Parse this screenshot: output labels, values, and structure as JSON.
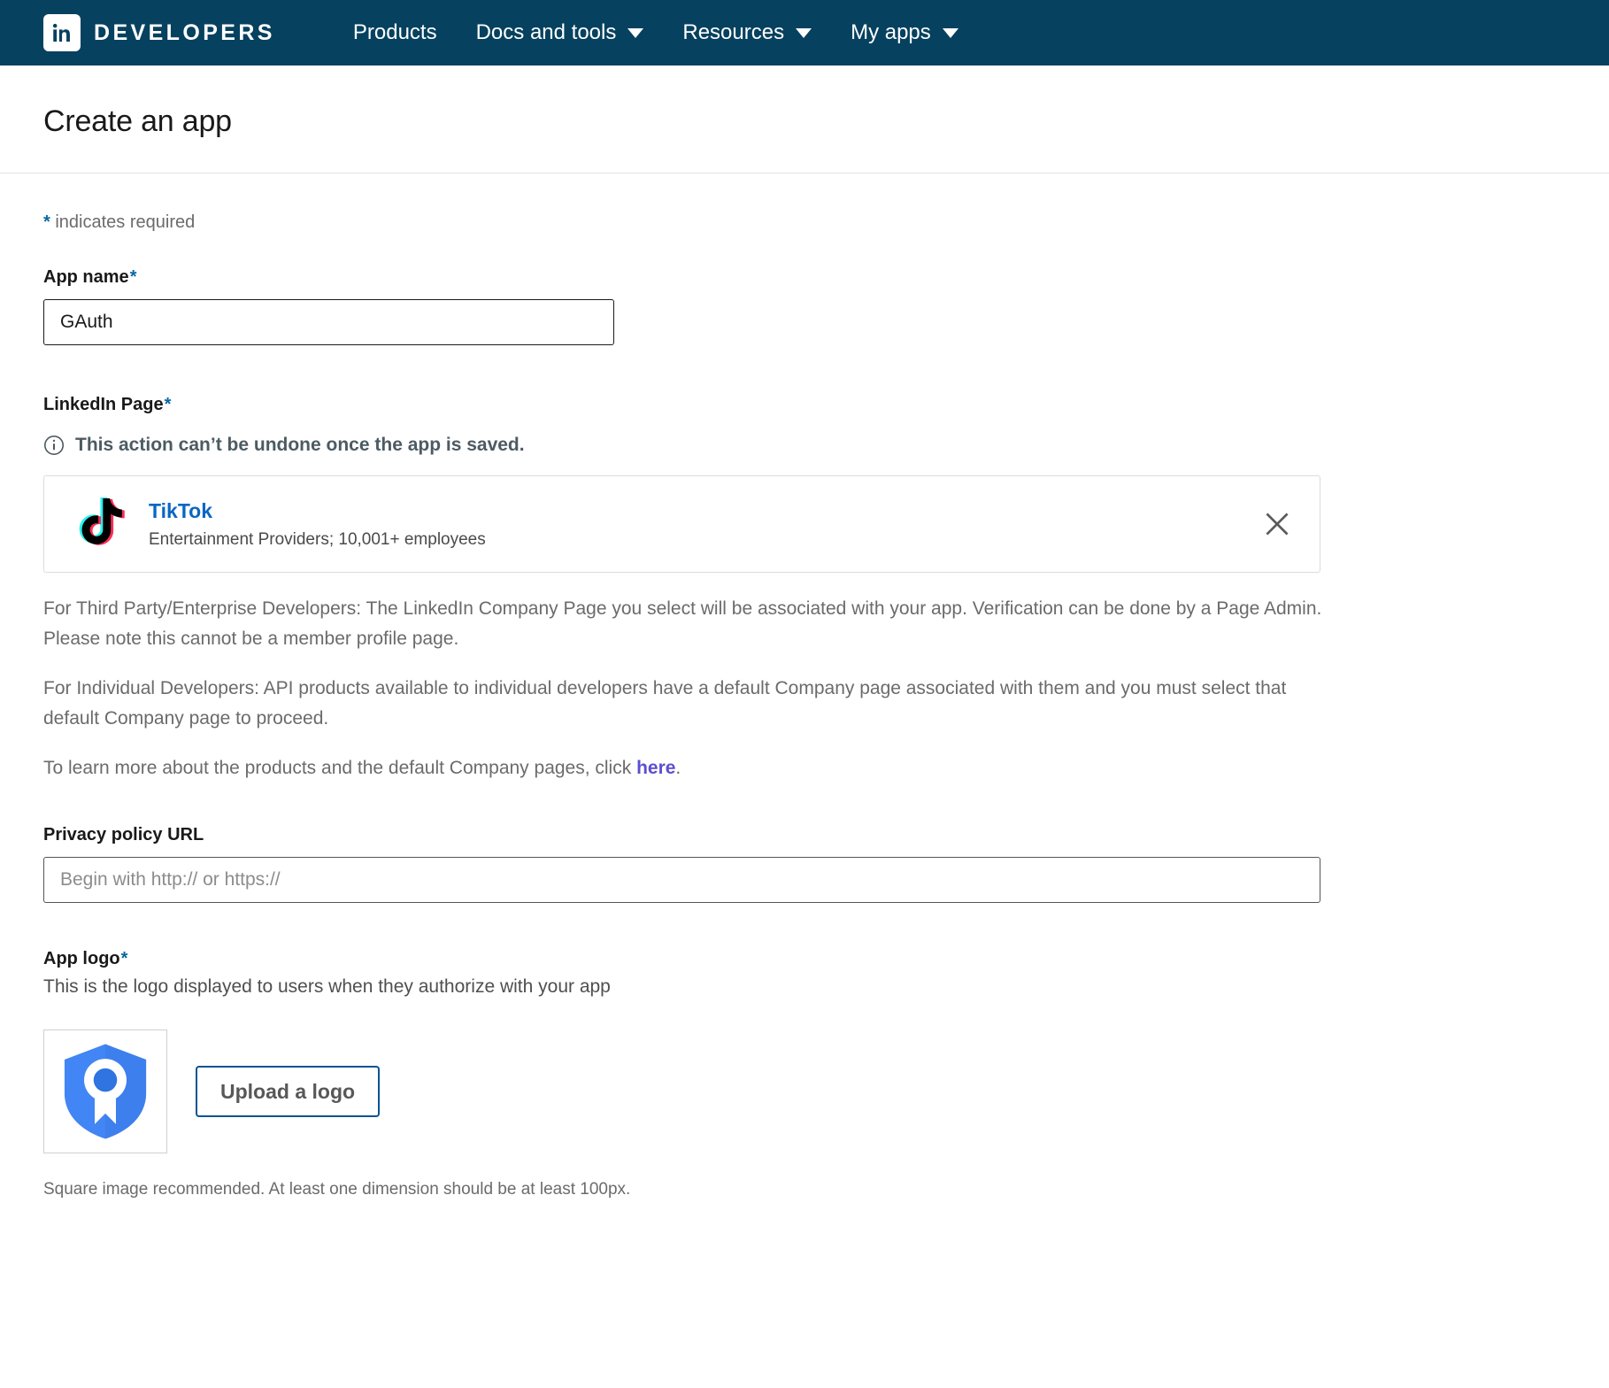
{
  "nav": {
    "brand_word": "DEVELOPERS",
    "brand_icon": "linkedin-in-icon",
    "items": [
      {
        "label": "Products",
        "has_caret": false
      },
      {
        "label": "Docs and tools",
        "has_caret": true
      },
      {
        "label": "Resources",
        "has_caret": true
      },
      {
        "label": "My apps",
        "has_caret": true
      }
    ]
  },
  "header": {
    "title": "Create an app"
  },
  "form": {
    "required_note": "indicates required",
    "required_star": "*",
    "app_name": {
      "label": "App name",
      "value": "GAuth"
    },
    "linkedin_page": {
      "label": "LinkedIn Page",
      "info_text": "This action can’t be undone once the app is saved.",
      "info_icon": "info-circle-icon",
      "company": {
        "name": "TikTok",
        "subtitle": "Entertainment Providers; 10,001+ employees",
        "logo_icon": "tiktok-logo-icon",
        "remove_icon": "close-icon"
      },
      "paragraph_1": "For Third Party/Enterprise Developers: The LinkedIn Company Page you select will be associated with your app. Verification can be done by a Page Admin. Please note this cannot be a member profile page.",
      "paragraph_2": "For Individual Developers: API products available to individual developers have a default Company page associated with them and you must select that default Company page to proceed.",
      "paragraph_3_prefix": "To learn more about the products and the default Company pages, click ",
      "paragraph_3_link": "here",
      "paragraph_3_suffix": "."
    },
    "privacy_policy": {
      "label": "Privacy policy URL",
      "placeholder": "Begin with http:// or https://",
      "value": ""
    },
    "app_logo": {
      "label": "App logo",
      "description": "This is the logo displayed to users when they authorize with your app",
      "preview_icon": "shield-badge-icon",
      "upload_button": "Upload a logo",
      "footnote": "Square image recommended. At least one dimension should be at least 100px."
    }
  },
  "colors": {
    "navbar_bg": "#06415f",
    "accent_blue": "#0b66a3",
    "link_blue": "#0a66c2",
    "link_purple": "#5b4fcf",
    "button_border": "#0b5394",
    "tiktok_cyan": "#25f4ee",
    "tiktok_pink": "#fe2c55",
    "shield_blue": "#4285f4"
  }
}
